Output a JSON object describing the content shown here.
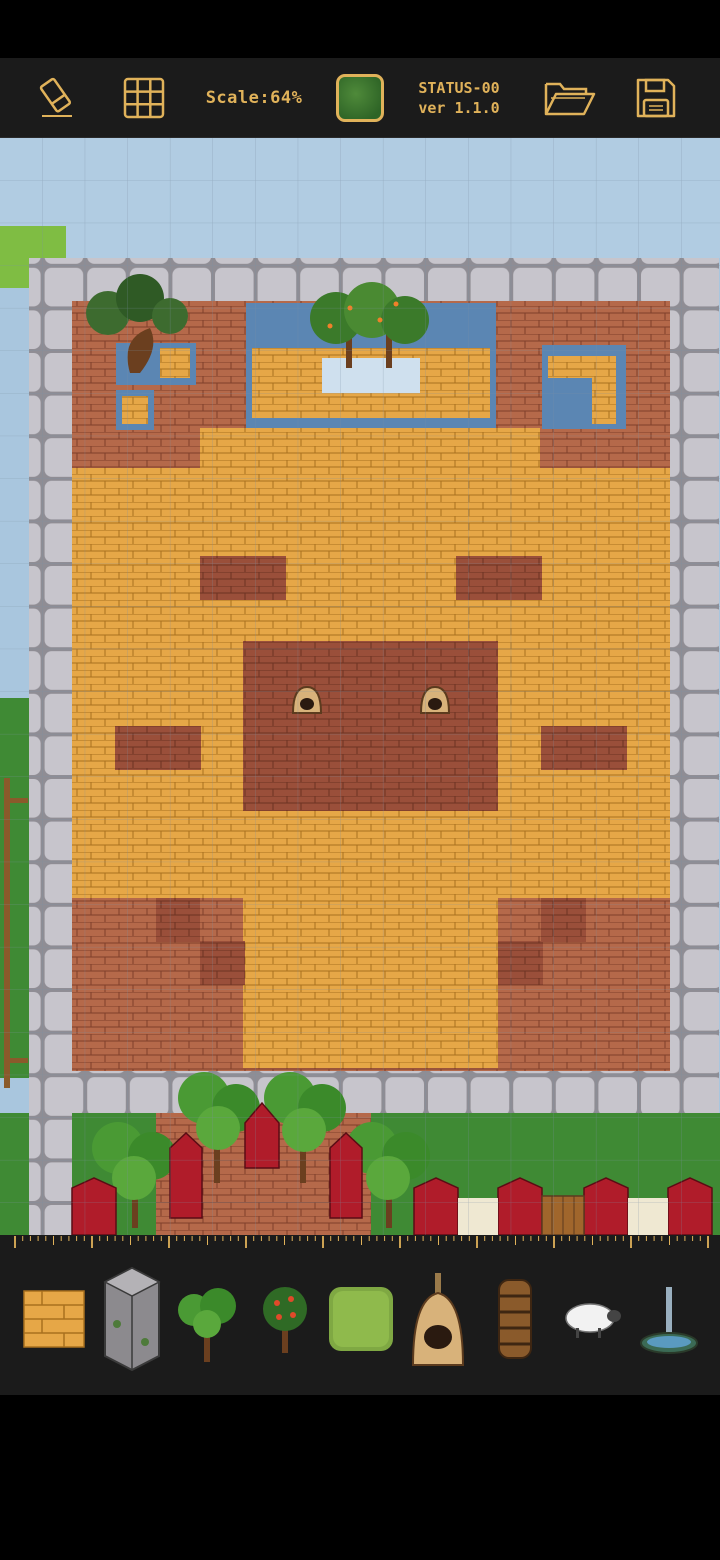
{
  "toolbar": {
    "scale_label": "Scale:64%",
    "status_line": "STATUS-00",
    "version_line": "ver 1.1.0",
    "current_color": "#3f7a32",
    "accent": "#e0b25a",
    "icons": [
      "eraser-icon",
      "grid-icon",
      "folder-open-icon",
      "save-icon"
    ]
  },
  "palette": {
    "items": [
      "sand-brick-tile",
      "stone-pillar",
      "green-tree",
      "orange-tree",
      "grass-tile",
      "clay-oven",
      "wooden-barrel",
      "sheep",
      "fountain"
    ]
  },
  "colors": {
    "water": "#a9c6de",
    "grass": "#3f8a34",
    "wall_stone": "#bdbbc2",
    "brick": "#b5694a",
    "dark_brick": "#9a4f3a",
    "sand_brick": "#e6a747",
    "fence_red": "#b01c2a"
  }
}
